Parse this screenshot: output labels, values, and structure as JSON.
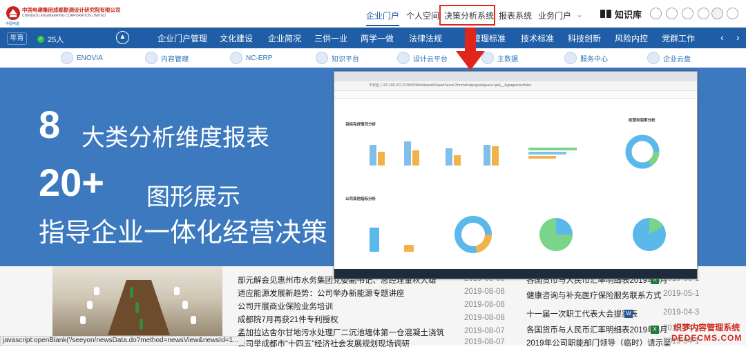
{
  "header": {
    "logo_cn": "中国电建集团成都勘测设计研究院有限公司",
    "logo_en": "CHENGDU ENGINEERING CORPORATION LIMITED",
    "logo_brand": "中国电建",
    "nav": [
      "企业门户",
      "个人空间",
      "决策分析系统",
      "报表系统",
      "业务门户"
    ],
    "knowledge": "知识库"
  },
  "bluebar": {
    "lang": "年育",
    "online": "25人",
    "items": [
      "企业门户管理",
      "文化建设",
      "企业简况",
      "三供一业",
      "两学一做",
      "法律法规",
      "管理标准",
      "技术标准",
      "科技创新",
      "风险内控",
      "党群工作"
    ]
  },
  "apps": [
    "ENOVIA",
    "内容管理",
    "NC-ERP",
    "知识平台",
    "设计云平台",
    "主数据",
    "服务中心",
    "企业云盘"
  ],
  "overlay": {
    "line1_num": "8",
    "line1_text": "大类分析维度报表",
    "line2_num": "20+",
    "line2_text": "图形展示",
    "line3": "指导企业一体化经营决策"
  },
  "screenshot": {
    "url": "不安全 | 192.168.102.22:8090/WebReport/ReportServer?formlet=qiyeguanlijuece.cpt&__bypagesize=false",
    "sec1_title": "目标完成情况分析",
    "sec1_right_title": "经营利润率分析",
    "sec2_title": "公司其他指标分析"
  },
  "news_left": [
    {
      "title": "部元解会见惠州市水务集团党委副书记、总经理董秋大雄",
      "date": "2019-08-09"
    },
    {
      "title": "适应能源发展新趋势：公司举办新能源专题讲座",
      "date": "2019-08-08"
    },
    {
      "title": "公司开展商业保险业务培训",
      "date": "2019-08-08"
    },
    {
      "title": "成都院7月再获21件专利授权",
      "date": "2019-08-08"
    },
    {
      "title": "孟加拉达舍尔甘地污水处理厂二沉池墙体第一仓混凝土浇筑",
      "date": "2019-08-07"
    },
    {
      "title": "公司举成都市“十四五”经济社会发展规划现场调研",
      "date": "2019-08-07"
    }
  ],
  "news_right": [
    {
      "title": "各国货币与人民币汇率明细表2019年6月",
      "date": "2019-06-1"
    },
    {
      "title": "健康咨询与补充医疗保险服务联系方式",
      "date": "2019-05-1"
    },
    {
      "title": "十一届一次职工代表大会提案表",
      "date": "2019-04-3"
    },
    {
      "title": "各国货币与人民币汇率明细表2019年5月",
      "date": "2019-04-2"
    },
    {
      "title": "2019年公司职能部门领导（临时）请示呈",
      "date": "2019-04-1"
    }
  ],
  "status": "javascript:openBlank('/seeyon/newsData.do?method=newsView&newsId=1...",
  "watermark": {
    "w1": "织梦内容管理系统",
    "w2": "DEDECMS.COM"
  }
}
